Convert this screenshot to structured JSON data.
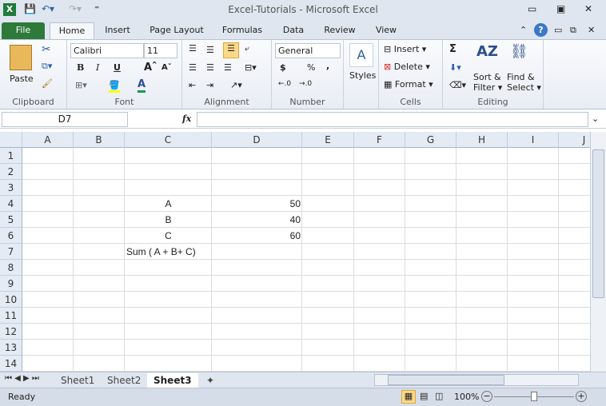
{
  "window": {
    "title": "Excel-Tutorials  -  Microsoft Excel"
  },
  "tabs": [
    "File",
    "Home",
    "Insert",
    "Page Layout",
    "Formulas",
    "Data",
    "Review",
    "View"
  ],
  "ribbon": {
    "clipboard": {
      "label": "Clipboard",
      "paste": "Paste"
    },
    "font": {
      "label": "Font",
      "name": "Calibri",
      "size": "11",
      "bold": "B",
      "italic": "I",
      "underline": "U"
    },
    "alignment": {
      "label": "Alignment"
    },
    "number": {
      "label": "Number",
      "format": "General",
      "currency": "$",
      "percent": "%",
      "comma": ","
    },
    "styles": {
      "label": "Styles"
    },
    "cells": {
      "label": "Cells",
      "insert": "Insert",
      "delete": "Delete",
      "format": "Format"
    },
    "editing": {
      "label": "Editing",
      "sum": "Σ",
      "sort": "Sort &",
      "filter": "Filter",
      "find": "Find &",
      "select": "Select"
    }
  },
  "formula_bar": {
    "name_box": "D7",
    "fx": "fx",
    "value": ""
  },
  "columns": [
    "A",
    "B",
    "C",
    "D",
    "E",
    "F",
    "G",
    "H",
    "I",
    "J"
  ],
  "rows": [
    "1",
    "2",
    "3",
    "4",
    "5",
    "6",
    "7",
    "8",
    "9",
    "10",
    "11",
    "12",
    "13",
    "14"
  ],
  "cells": {
    "C4": "A",
    "D4": "50",
    "C5": "B",
    "D5": "40",
    "C6": "C",
    "D6": "60",
    "C7": "Sum ( A + B+ C)"
  },
  "sheets": [
    "Sheet1",
    "Sheet2",
    "Sheet3"
  ],
  "active_sheet": "Sheet3",
  "status": {
    "ready": "Ready",
    "zoom": "100%"
  }
}
